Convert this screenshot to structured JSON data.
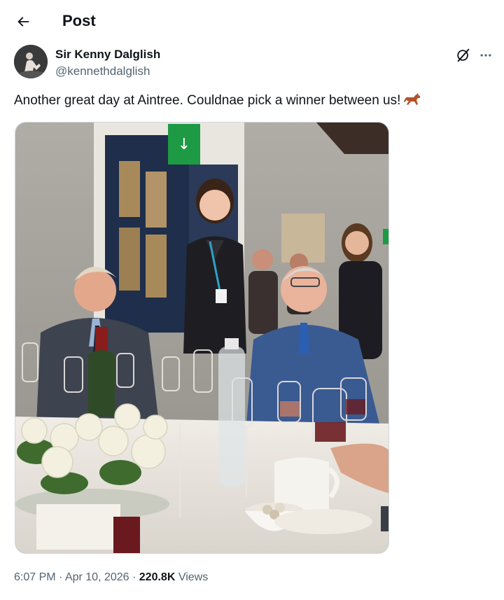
{
  "header": {
    "title": "Post",
    "back_icon": "arrow-left-icon"
  },
  "author": {
    "name": "Sir Kenny Dalglish",
    "handle": "@kennethdalglish"
  },
  "actions": {
    "grok_icon": "grok-icon",
    "more_icon": "more-horizontal-icon"
  },
  "post": {
    "text": "Another great day at Aintree. Couldnae pick a winner between us!",
    "emoji_icon": "horse-icon"
  },
  "media": {
    "type": "photo",
    "sign_text": "↓"
  },
  "meta": {
    "time": "6:07 PM",
    "sep1": " · ",
    "date": "Apr 10, 2026",
    "sep2": " · ",
    "views_count": "220.8K",
    "views_label": " Views"
  },
  "colors": {
    "text": "#0f1419",
    "secondary": "#536471",
    "border": "#cfd9de"
  }
}
